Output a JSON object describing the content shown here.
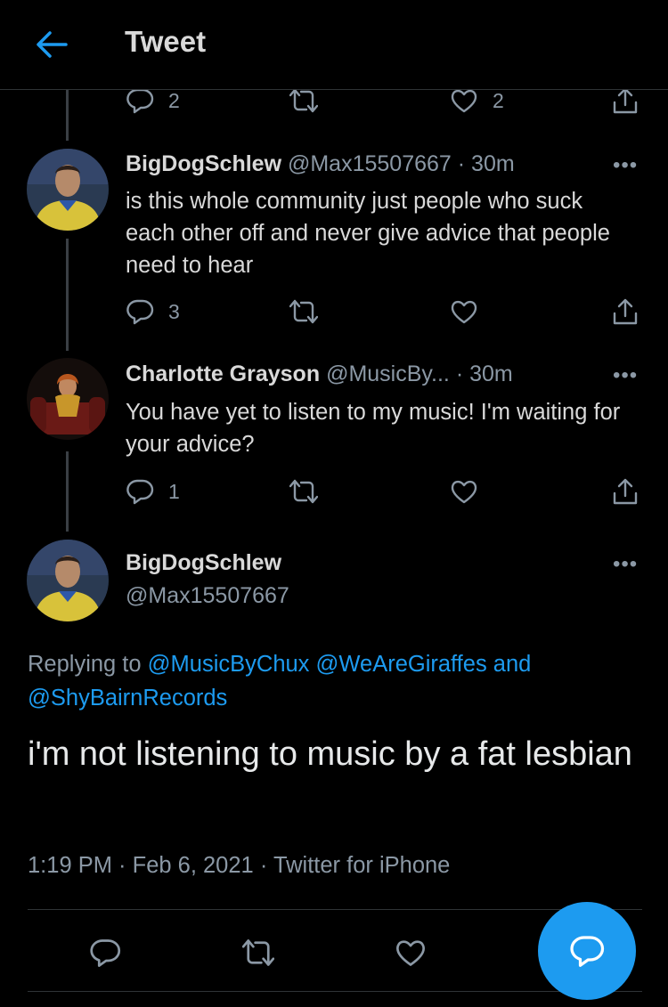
{
  "header": {
    "title": "Tweet"
  },
  "top_actions": {
    "replies": "2",
    "likes": "2"
  },
  "tweets": [
    {
      "name": "BigDogSchlew",
      "handle": "@Max15507667",
      "time": "· 30m",
      "text": "is this whole community just people who suck each other off and never give advice that people need to hear",
      "replies": "3"
    },
    {
      "name": "Charlotte Grayson",
      "handle": "@MusicBy...",
      "time": "· 30m",
      "text": "You have yet to listen to my music! I'm waiting for your advice?",
      "replies": "1"
    }
  ],
  "main": {
    "name": "BigDogSchlew",
    "handle": "@Max15507667",
    "replying_label": "Replying to",
    "mention1": "@MusicByChux",
    "mention2": "@WeAreGiraffes",
    "and_word": "and",
    "mention3": "@ShyBairnRecords",
    "text": "i'm not listening to music by a fat lesbian",
    "timestamp": "1:19 PM · Feb 6, 2021 · ",
    "source": "Twitter for iPhone"
  },
  "more_symbol": "•••",
  "colors": {
    "accent": "#1d9bf0",
    "background": "#000000",
    "muted": "#8b98a5"
  }
}
